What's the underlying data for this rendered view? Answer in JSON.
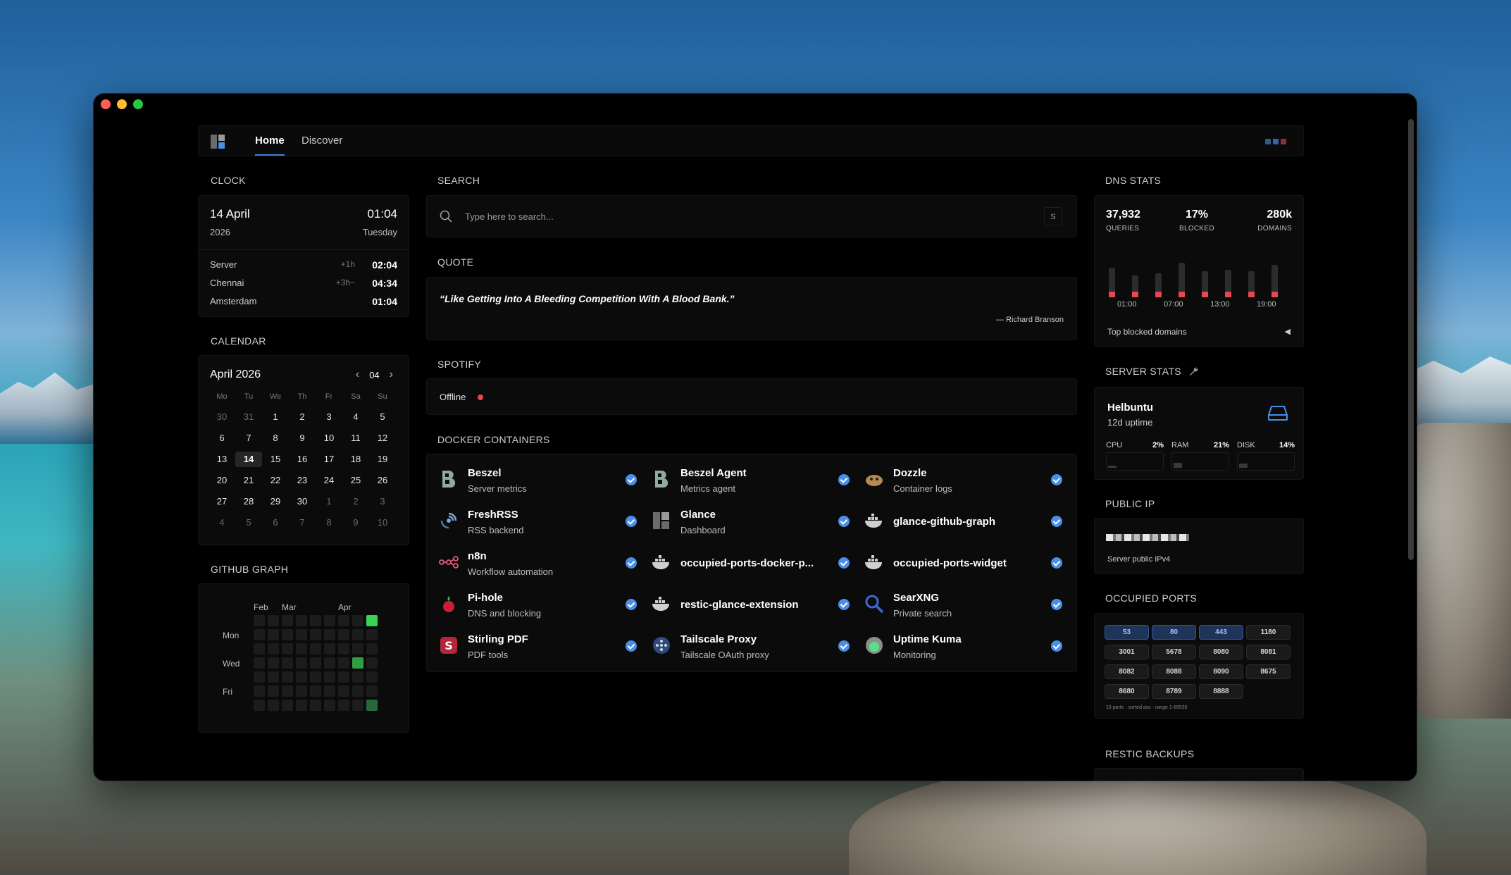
{
  "nav": {
    "tabs": [
      {
        "label": "Home",
        "active": true
      },
      {
        "label": "Discover",
        "active": false
      }
    ]
  },
  "clock": {
    "title": "CLOCK",
    "date": "14 April",
    "year": "2026",
    "time": "01:04",
    "day": "Tuesday",
    "zones": [
      {
        "name": "Server",
        "offset": "+1h",
        "time": "02:04"
      },
      {
        "name": "Chennai",
        "offset": "+3h~",
        "time": "04:34"
      },
      {
        "name": "Amsterdam",
        "offset": "",
        "time": "01:04"
      }
    ]
  },
  "calendar": {
    "title": "CALENDAR",
    "month": "April 2026",
    "month_num": "04",
    "weekdays": [
      "Mo",
      "Tu",
      "We",
      "Th",
      "Fr",
      "Sa",
      "Su"
    ],
    "days": [
      {
        "d": "30",
        "m": true
      },
      {
        "d": "31",
        "m": true
      },
      {
        "d": "1"
      },
      {
        "d": "2"
      },
      {
        "d": "3"
      },
      {
        "d": "4"
      },
      {
        "d": "5"
      },
      {
        "d": "6"
      },
      {
        "d": "7"
      },
      {
        "d": "8"
      },
      {
        "d": "9"
      },
      {
        "d": "10"
      },
      {
        "d": "11"
      },
      {
        "d": "12"
      },
      {
        "d": "13"
      },
      {
        "d": "14",
        "today": true
      },
      {
        "d": "15"
      },
      {
        "d": "16"
      },
      {
        "d": "17"
      },
      {
        "d": "18"
      },
      {
        "d": "19"
      },
      {
        "d": "20"
      },
      {
        "d": "21"
      },
      {
        "d": "22"
      },
      {
        "d": "23"
      },
      {
        "d": "24"
      },
      {
        "d": "25"
      },
      {
        "d": "26"
      },
      {
        "d": "27"
      },
      {
        "d": "28"
      },
      {
        "d": "29"
      },
      {
        "d": "30"
      },
      {
        "d": "1",
        "m": true
      },
      {
        "d": "2",
        "m": true
      },
      {
        "d": "3",
        "m": true
      },
      {
        "d": "4",
        "m": true
      },
      {
        "d": "5",
        "m": true
      },
      {
        "d": "6",
        "m": true
      },
      {
        "d": "7",
        "m": true
      },
      {
        "d": "8",
        "m": true
      },
      {
        "d": "9",
        "m": true
      },
      {
        "d": "10",
        "m": true
      }
    ]
  },
  "github": {
    "title": "GITHUB GRAPH",
    "months": [
      "Feb",
      "Mar",
      "Apr"
    ],
    "days": [
      "Mon",
      "Wed",
      "Fri"
    ]
  },
  "search": {
    "title": "SEARCH",
    "placeholder": "Type here to search...",
    "shortcut": "S"
  },
  "quote": {
    "title": "QUOTE",
    "text": "“Like Getting Into A Bleeding Competition With A Blood Bank.”",
    "author": "— Richard Branson"
  },
  "spotify": {
    "title": "SPOTIFY",
    "status": "Offline",
    "status_color": "#e5484d"
  },
  "docker": {
    "title": "DOCKER CONTAINERS",
    "items": [
      {
        "name": "Beszel",
        "desc": "Server metrics",
        "icon": "beszel-icon"
      },
      {
        "name": "Beszel Agent",
        "desc": "Metrics agent",
        "icon": "beszel-icon"
      },
      {
        "name": "Dozzle",
        "desc": "Container logs",
        "icon": "dozzle-icon"
      },
      {
        "name": "FreshRSS",
        "desc": "RSS backend",
        "icon": "freshrss-icon"
      },
      {
        "name": "Glance",
        "desc": "Dashboard",
        "icon": "glance-icon"
      },
      {
        "name": "glance-github-graph",
        "desc": "",
        "icon": "docker-icon"
      },
      {
        "name": "n8n",
        "desc": "Workflow automation",
        "icon": "n8n-icon"
      },
      {
        "name": "occupied-ports-docker-p...",
        "desc": "",
        "icon": "docker-icon"
      },
      {
        "name": "occupied-ports-widget",
        "desc": "",
        "icon": "docker-icon"
      },
      {
        "name": "Pi-hole",
        "desc": "DNS and blocking",
        "icon": "pihole-icon"
      },
      {
        "name": "restic-glance-extension",
        "desc": "",
        "icon": "docker-icon"
      },
      {
        "name": "SearXNG",
        "desc": "Private search",
        "icon": "searxng-icon"
      },
      {
        "name": "Stirling PDF",
        "desc": "PDF tools",
        "icon": "stirling-pdf-icon"
      },
      {
        "name": "Tailscale Proxy",
        "desc": "Tailscale OAuth proxy",
        "icon": "tailscale-icon"
      },
      {
        "name": "Uptime Kuma",
        "desc": "Monitoring",
        "icon": "uptime-kuma-icon"
      }
    ]
  },
  "dns": {
    "title": "DNS STATS",
    "stats": [
      {
        "value": "37,932",
        "label": "QUERIES"
      },
      {
        "value": "17%",
        "label": "BLOCKED"
      },
      {
        "value": "280k",
        "label": "DOMAINS"
      }
    ],
    "bars": [
      0.62,
      0.45,
      0.5,
      0.72,
      0.55,
      0.58,
      0.55,
      0.68
    ],
    "x_labels": [
      "01:00",
      "07:00",
      "13:00",
      "19:00"
    ],
    "footer": "Top blocked domains"
  },
  "server": {
    "title": "SERVER STATS",
    "name": "Helbuntu",
    "uptime": "12d uptime",
    "meters": [
      {
        "label": "CPU",
        "value": "2%",
        "level": 0.02
      },
      {
        "label": "RAM",
        "value": "21%",
        "level": 0.21
      },
      {
        "label": "DISK",
        "value": "14%",
        "level": 0.14
      }
    ]
  },
  "public_ip": {
    "title": "PUBLIC IP",
    "label": "Server public IPv4"
  },
  "ports": {
    "title": "OCCUPIED PORTS",
    "items": [
      {
        "p": "53",
        "hl": true
      },
      {
        "p": "80",
        "hl": true
      },
      {
        "p": "443",
        "hl": true
      },
      {
        "p": "1180"
      },
      {
        "p": "3001"
      },
      {
        "p": "5678"
      },
      {
        "p": "8080"
      },
      {
        "p": "8081"
      },
      {
        "p": "8082"
      },
      {
        "p": "8088"
      },
      {
        "p": "8090"
      },
      {
        "p": "8675"
      },
      {
        "p": "8680"
      },
      {
        "p": "8789"
      },
      {
        "p": "8888"
      }
    ],
    "note": "15 ports · sorted asc · range 1-65535"
  },
  "restic": {
    "title": "RESTIC BACKUPS"
  },
  "colors": {
    "accent": "#3d82d6",
    "check": "#4a8fe7",
    "danger": "#e5484d",
    "gh_green": "#39d353"
  }
}
